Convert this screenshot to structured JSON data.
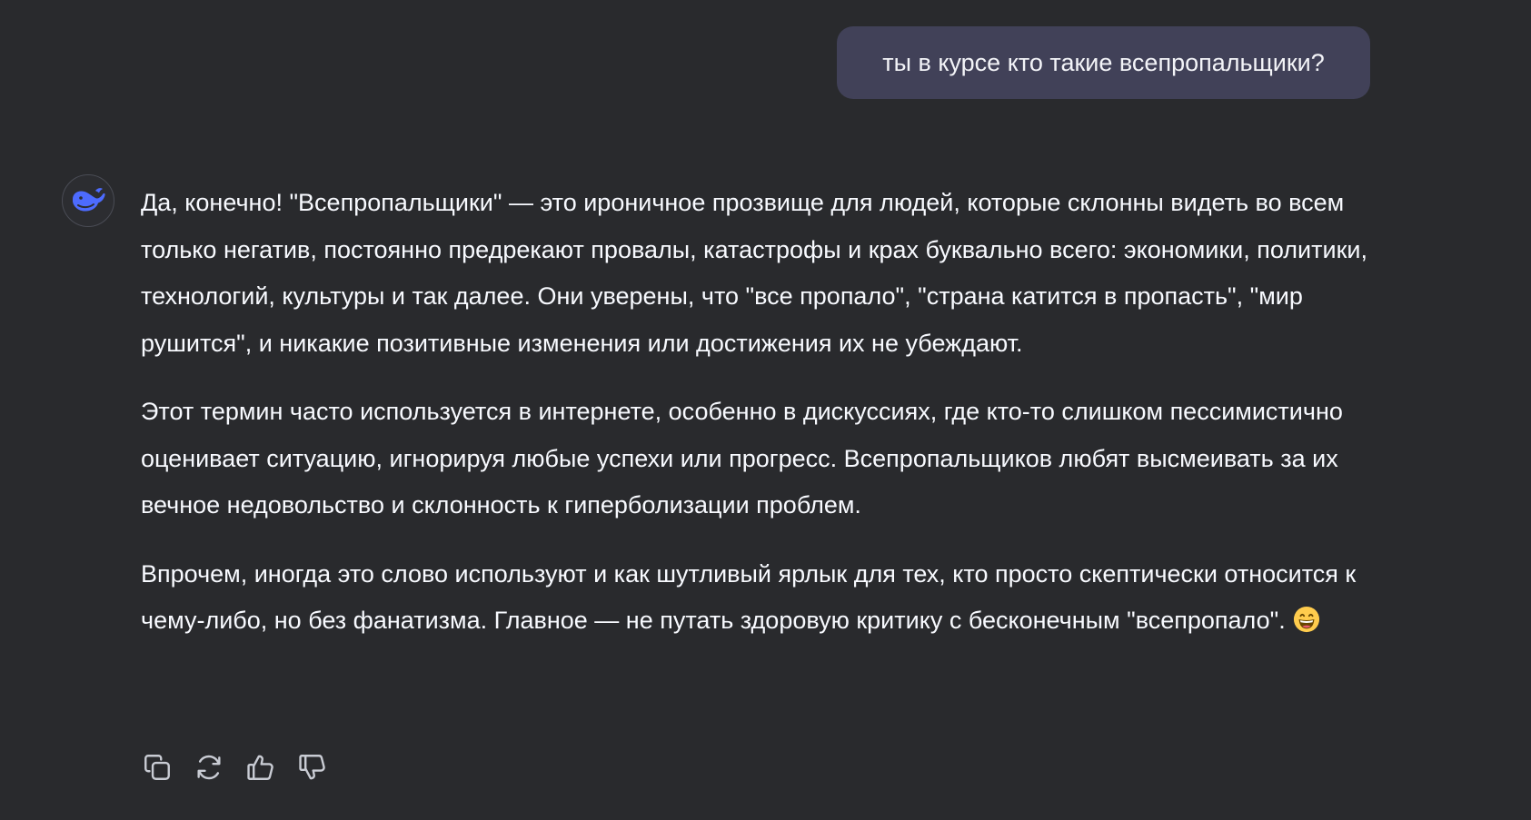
{
  "conversation": {
    "user_message": "ты в курсе кто такие всепропальщики?",
    "assistant": {
      "avatar_icon": "deepseek-whale-icon",
      "accent_color": "#4d6bfe",
      "paragraphs": [
        "Да, конечно! \"Всепропальщики\" — это ироничное прозвище для людей, которые склонны видеть во всем только негатив, постоянно предрекают провалы, катастрофы и крах буквально всего: экономики, политики, технологий, культуры и так далее. Они уверены, что \"все пропало\", \"страна катится в пропасть\", \"мир рушится\", и никакие позитивные изменения или достижения их не убеждают.",
        "Этот термин часто используется в интернете, особенно в дискуссиях, где кто-то слишком пессимистично оценивает ситуацию, игнорируя любые успехи или прогресс. Всепропальщиков любят высмеивать за их вечное недовольство и склонность к гиперболизации проблем.",
        "Впрочем, иногда это слово используют и как шутливый ярлык для тех, кто просто скептически относится к чему-либо, но без фанатизма. Главное — не путать здоровую критику с бесконечным \"всепропало\"."
      ],
      "emoji_icon": "grinning-face-emoji",
      "actions": [
        "copy-icon",
        "regenerate-icon",
        "thumbs-up-icon",
        "thumbs-down-icon"
      ]
    }
  },
  "colors": {
    "background": "#292a2d",
    "user_bubble": "#414158",
    "text": "#f8faff",
    "icon": "#c9ccd4"
  }
}
